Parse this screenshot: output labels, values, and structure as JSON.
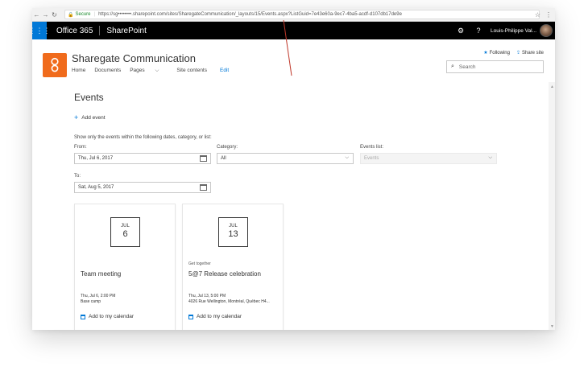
{
  "browser": {
    "secure_label": "Secure",
    "url": "https://sg••••••••.sharepoint.com/sites/SharegateCommunication/_layouts/15/Events.aspx?ListGuid=7e43e60a-9ec7-4ba5-acdf-d107db17de9e"
  },
  "suite_bar": {
    "office": "Office 365",
    "app": "SharePoint",
    "user": "Louis-Philippe Val..."
  },
  "site": {
    "title": "Sharegate Communication",
    "nav": {
      "home": "Home",
      "documents": "Documents",
      "pages": "Pages",
      "site_contents": "Site contents",
      "edit": "Edit"
    },
    "following": "Following",
    "share": "Share site",
    "search_placeholder": "Search"
  },
  "events_page": {
    "title": "Events",
    "add_event": "Add event",
    "filter_description": "Show only the events within the following dates, category, or list:",
    "from_label": "From:",
    "from_value": "Thu, Jul 6, 2017",
    "to_label": "To:",
    "to_value": "Sat, Aug 5, 2017",
    "category_label": "Category:",
    "category_value": "All",
    "events_list_label": "Events list:",
    "events_list_value": "Events"
  },
  "cards": [
    {
      "month": "JUL",
      "day": "6",
      "category": "",
      "title": "Team meeting",
      "when": "Thu, Jul 6, 2:00 PM",
      "where": "Base camp",
      "add_calendar": "Add to my calendar"
    },
    {
      "month": "JUL",
      "day": "13",
      "category": "Get together",
      "title": "5@7 Release celebration",
      "when": "Thu, Jul 13, 5:00 PM",
      "where": "4026 Rue Wellington, Montréal, Québec H4...",
      "add_calendar": "Add to my calendar"
    }
  ],
  "colors": {
    "accent": "#0078d7",
    "site_logo": "#f06b1c",
    "suite_bar": "#000000",
    "annotation_line": "#c0392b"
  },
  "icons": [
    "back-icon",
    "forward-icon",
    "reload-icon",
    "lock-icon",
    "star-icon",
    "menu-icon",
    "waffle-icon",
    "gear-icon",
    "help-icon",
    "search-icon",
    "calendar-icon",
    "chevron-down-icon",
    "plus-icon"
  ]
}
